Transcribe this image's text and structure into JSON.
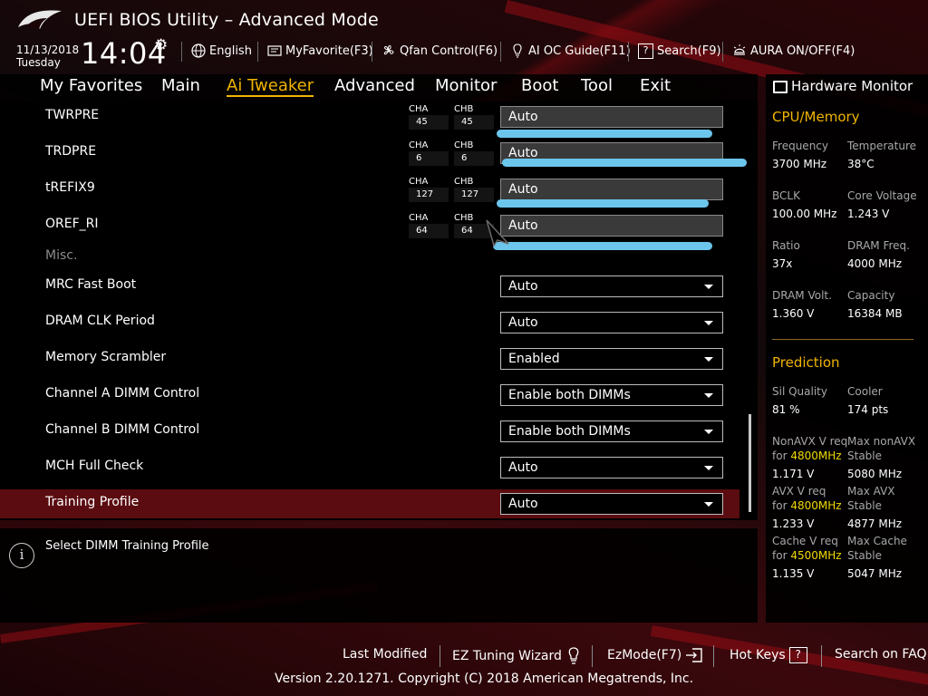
{
  "app": {
    "title": "UEFI BIOS Utility – Advanced Mode",
    "date": "11/13/2018",
    "day": "Tuesday",
    "time": "14:04"
  },
  "toolbar": {
    "language": "English",
    "myfavorite": "MyFavorite(F3)",
    "qfan": "Qfan Control(F6)",
    "aioc": "AI OC Guide(F11)",
    "search": "Search(F9)",
    "aura": "AURA ON/OFF(F4)"
  },
  "nav": {
    "tabs": [
      "My Favorites",
      "Main",
      "Ai Tweaker",
      "Advanced",
      "Monitor",
      "Boot",
      "Tool",
      "Exit"
    ],
    "active": "Ai Tweaker"
  },
  "timings": [
    {
      "label": "TWRPRE",
      "cha": "45",
      "chb": "45",
      "value": "Auto"
    },
    {
      "label": "TRDPRE",
      "cha": "6",
      "chb": "6",
      "value": "Auto"
    },
    {
      "label": "tREFIX9",
      "cha": "127",
      "chb": "127",
      "value": "Auto"
    },
    {
      "label": "OREF_RI",
      "cha": "64",
      "chb": "64",
      "value": "Auto"
    }
  ],
  "channel_labels": {
    "a": "CHA",
    "b": "CHB"
  },
  "misc_section": "Misc.",
  "settings": [
    {
      "label": "MRC Fast Boot",
      "value": "Auto"
    },
    {
      "label": "DRAM CLK Period",
      "value": "Auto"
    },
    {
      "label": "Memory Scrambler",
      "value": "Enabled"
    },
    {
      "label": "Channel A DIMM Control",
      "value": "Enable both DIMMs"
    },
    {
      "label": "Channel B DIMM Control",
      "value": "Enable both DIMMs"
    },
    {
      "label": "MCH Full Check",
      "value": "Auto"
    },
    {
      "label": "Training Profile",
      "value": "Auto"
    }
  ],
  "help": {
    "text": "Select DIMM Training Profile"
  },
  "hw": {
    "title": "Hardware Monitor",
    "cpu_section": "CPU/Memory",
    "frequency_label": "Frequency",
    "frequency": "3700 MHz",
    "temperature_label": "Temperature",
    "temperature": "38°C",
    "bclk_label": "BCLK",
    "bclk": "100.00 MHz",
    "core_voltage_label": "Core Voltage",
    "core_voltage": "1.243 V",
    "ratio_label": "Ratio",
    "ratio": "37x",
    "dram_freq_label": "DRAM Freq.",
    "dram_freq": "4000 MHz",
    "dram_volt_label": "DRAM Volt.",
    "dram_volt": "1.360 V",
    "capacity_label": "Capacity",
    "capacity": "16384 MB",
    "prediction_section": "Prediction",
    "sil_quality_label": "Sil Quality",
    "sil_quality": "81 %",
    "cooler_label": "Cooler",
    "cooler": "174 pts",
    "nonavx_req_label": "NonAVX V req",
    "for": "for",
    "nonavx_freq": "4800MHz",
    "nonavx_req": "1.171 V",
    "max_nonavx_label": "Max nonAVX",
    "stable": "Stable",
    "max_nonavx": "5080 MHz",
    "avx_req_label": "AVX V req",
    "avx_freq": "4800MHz",
    "avx_req": "1.233 V",
    "max_avx_label": "Max AVX",
    "max_avx": "4877 MHz",
    "cache_req_label": "Cache V req",
    "cache_freq": "4500MHz",
    "cache_req": "1.135 V",
    "max_cache_label": "Max Cache",
    "max_cache": "5047 MHz"
  },
  "footer": {
    "last_modified": "Last Modified",
    "ez_tuning": "EZ Tuning Wizard",
    "ezmode": "EzMode(F7)",
    "hotkeys": "Hot Keys",
    "hotkeys_key": "?",
    "search_faq": "Search on FAQ",
    "version": "Version 2.20.1271. Copyright (C) 2018 American Megatrends, Inc."
  },
  "colors": {
    "accent": "#f0b400",
    "selection": "#5a0c10",
    "highlight": "#f0d800",
    "scribble": "#6cc6ec"
  },
  "icons": [
    "rog-logo-icon",
    "gear-icon",
    "globe-icon",
    "favorite-icon",
    "fan-icon",
    "lightbulb-icon",
    "search-icon",
    "aura-icon",
    "monitor-icon",
    "info-icon",
    "wizard-bulb-icon",
    "exit-arrow-icon",
    "cursor-icon"
  ]
}
